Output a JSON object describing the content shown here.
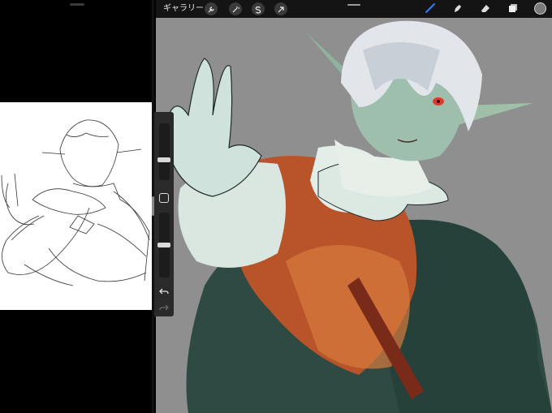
{
  "toolbar": {
    "gallery_label": "ギャラリー",
    "left_tools": [
      "wrench-icon",
      "magic-wand-icon",
      "selection-s-icon",
      "transform-arrow-icon"
    ],
    "right_tools": [
      "brush-icon",
      "smudge-icon",
      "eraser-icon",
      "layers-icon",
      "color-icon"
    ],
    "current_color": "#7a7a7a"
  },
  "sidebar": {
    "brush_size_level": 0.35,
    "opacity_level": 0.5
  },
  "colors": {
    "accent": "#2f7bff",
    "canvas_bg": "#8f8f8f"
  }
}
